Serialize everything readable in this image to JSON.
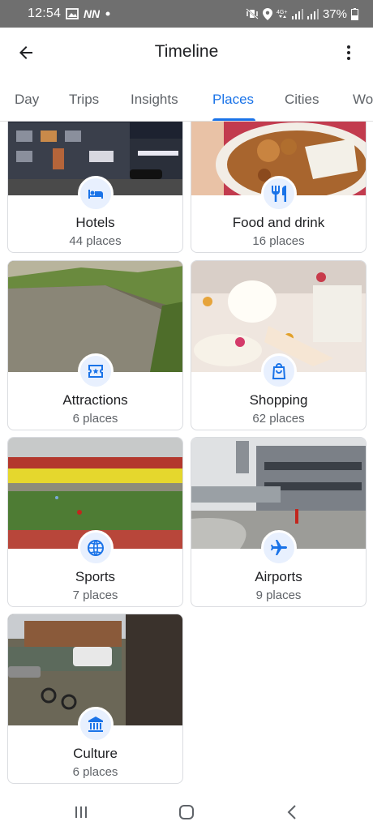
{
  "status_bar": {
    "time": "12:54",
    "battery": "37%",
    "notification_icons": [
      "image-icon",
      "n-icon",
      "n-icon",
      "dot-icon"
    ],
    "system_icons": [
      "mute-vibrate-icon",
      "location-icon",
      "4g-icon",
      "signal-icon",
      "signal-icon",
      "battery-icon"
    ]
  },
  "app_bar": {
    "title": "Timeline",
    "back_icon": "arrow-back-icon",
    "menu_icon": "more-vert-icon"
  },
  "tabs": [
    {
      "label": "Day",
      "active": false
    },
    {
      "label": "Trips",
      "active": false
    },
    {
      "label": "Insights",
      "active": false
    },
    {
      "label": "Places",
      "active": true
    },
    {
      "label": "Cities",
      "active": false
    },
    {
      "label": "Wo",
      "active": false
    }
  ],
  "accent_color": "#1a73e8",
  "categories": [
    {
      "title": "Hotels",
      "subtitle": "44 places",
      "icon": "hotel-bed-icon"
    },
    {
      "title": "Food and drink",
      "subtitle": "16 places",
      "icon": "restaurant-icon"
    },
    {
      "title": "Attractions",
      "subtitle": "6 places",
      "icon": "ticket-icon"
    },
    {
      "title": "Shopping",
      "subtitle": "62 places",
      "icon": "shopping-bag-icon"
    },
    {
      "title": "Sports",
      "subtitle": "7 places",
      "icon": "sports-ball-icon"
    },
    {
      "title": "Airports",
      "subtitle": "9 places",
      "icon": "airplane-icon"
    },
    {
      "title": "Culture",
      "subtitle": "6 places",
      "icon": "museum-icon"
    }
  ],
  "nav_bar": {
    "recents_icon": "recents-icon",
    "home_icon": "home-icon",
    "back_icon": "nav-back-icon"
  }
}
